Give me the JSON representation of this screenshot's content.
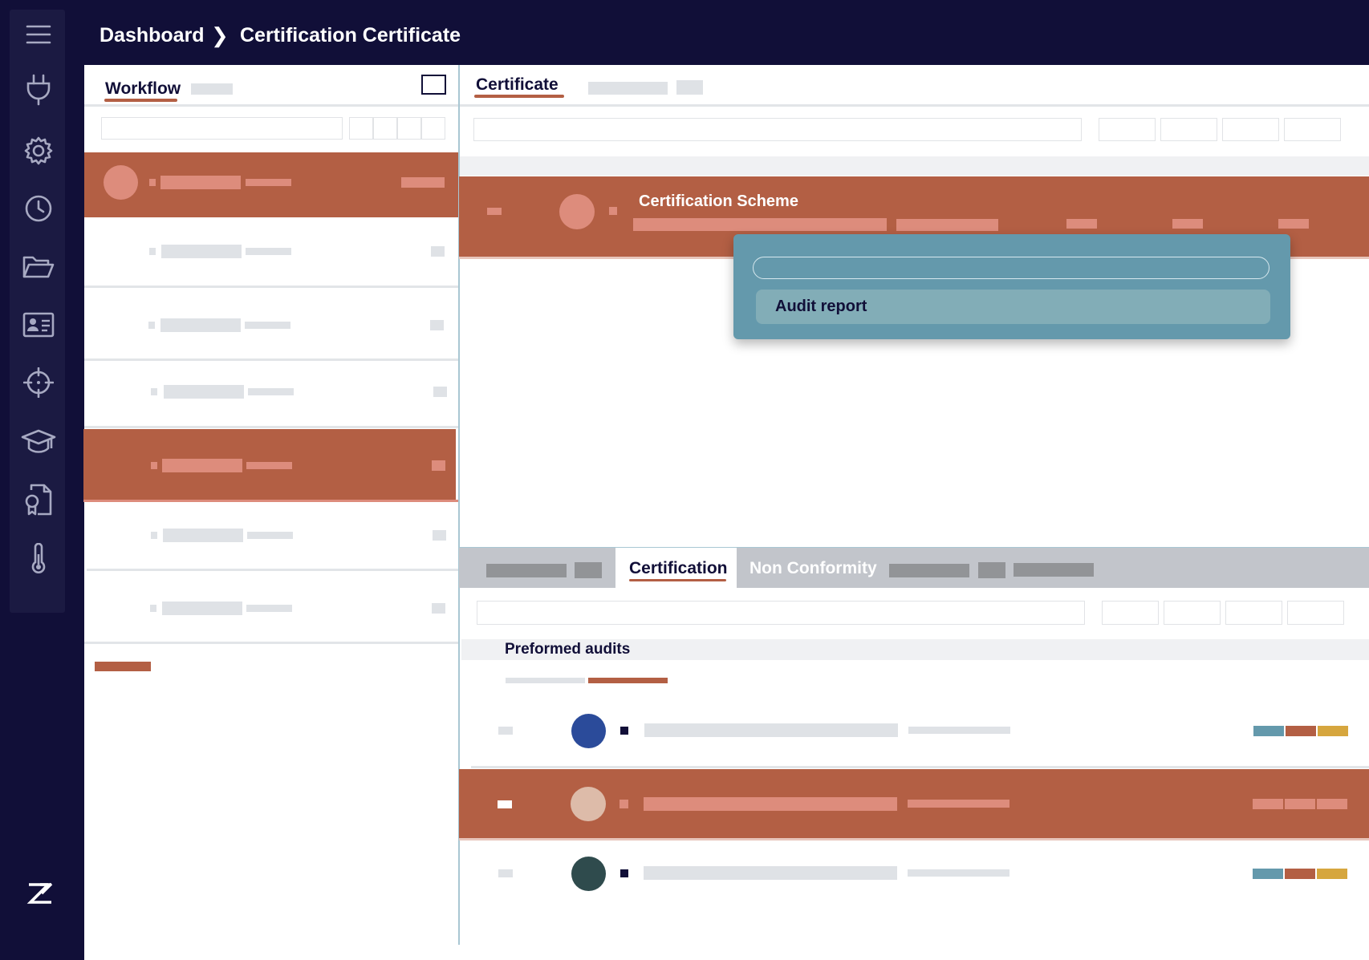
{
  "breadcrumb": {
    "home": "Dashboard",
    "separator": "❯",
    "current": "Certification Certificate"
  },
  "sidebar": {
    "icons": [
      "menu-icon",
      "plug-icon",
      "gear-icon",
      "clock-icon",
      "folder-icon",
      "id-card-icon",
      "crosshair-icon",
      "graduation-cap-icon",
      "certificate-file-icon",
      "thermometer-icon"
    ],
    "logo": "Z"
  },
  "left_panel": {
    "tab_label": "Workflow"
  },
  "right_panel": {
    "tab_label": "Certificate"
  },
  "selected_row": {
    "title": "Certification Scheme"
  },
  "popup": {
    "search_value": "",
    "item_label": "Audit report"
  },
  "bottom_tabs": {
    "active": "Certification",
    "next": "Non Conformity"
  },
  "section": {
    "title": "Preformed audits"
  },
  "colors": {
    "navy": "#110f38",
    "accent": "#b35f44",
    "accent_pale": "#dd8c7c",
    "popup": "#6499ac",
    "blue": "#2b4b9a",
    "teal": "#2f4b4d",
    "gold": "#d6a63e",
    "steel": "#6499ac"
  }
}
